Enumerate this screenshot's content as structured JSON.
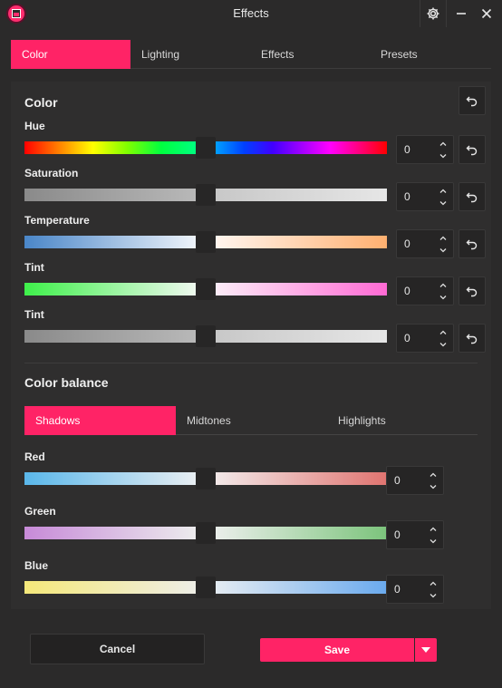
{
  "window": {
    "title": "Effects"
  },
  "tabs": [
    {
      "label": "Color",
      "active": true
    },
    {
      "label": "Lighting",
      "active": false
    },
    {
      "label": "Effects",
      "active": false
    },
    {
      "label": "Presets",
      "active": false
    }
  ],
  "color_section": {
    "title": "Color",
    "rows": [
      {
        "label": "Hue",
        "value": "0"
      },
      {
        "label": "Saturation",
        "value": "0"
      },
      {
        "label": "Temperature",
        "value": "0"
      },
      {
        "label": "Tint",
        "value": "0"
      },
      {
        "label": "Tint",
        "value": "0"
      }
    ]
  },
  "balance_section": {
    "title": "Color balance",
    "tabs": [
      {
        "label": "Shadows",
        "active": true
      },
      {
        "label": "Midtones",
        "active": false
      },
      {
        "label": "Highlights",
        "active": false
      }
    ],
    "rows": [
      {
        "label": "Red",
        "value": "0"
      },
      {
        "label": "Green",
        "value": "0"
      },
      {
        "label": "Blue",
        "value": "0"
      }
    ]
  },
  "footer": {
    "cancel_label": "Cancel",
    "save_label": "Save"
  },
  "colors": {
    "accent": "#ff2366",
    "background": "#2b2a2a",
    "panel": "#2f2e2e"
  }
}
